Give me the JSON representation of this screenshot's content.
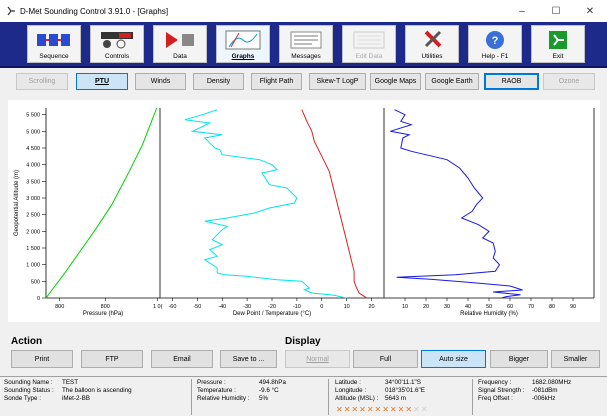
{
  "window": {
    "title": "D-Met Sounding Control 3.91.0 - [Graphs]",
    "minimize": "–",
    "maximize": "☐",
    "close": "✕"
  },
  "toolbar": [
    {
      "label": "Sequence",
      "icon": "sequence-icon",
      "state": "normal"
    },
    {
      "label": "Controls",
      "icon": "controls-icon",
      "state": "normal"
    },
    {
      "label": "Data",
      "icon": "data-icon",
      "state": "normal"
    },
    {
      "label": "Graphs",
      "icon": "graphs-icon",
      "state": "active"
    },
    {
      "label": "Messages",
      "icon": "messages-icon",
      "state": "normal"
    },
    {
      "label": "Edit Data",
      "icon": "edit-data-icon",
      "state": "disabled"
    },
    {
      "label": "Utilities",
      "icon": "utilities-icon",
      "state": "normal"
    },
    {
      "label": "Help - F1",
      "icon": "help-icon",
      "state": "normal"
    },
    {
      "label": "Exit",
      "icon": "exit-icon",
      "state": "normal"
    }
  ],
  "tabs": [
    {
      "label": "Scrolling",
      "state": "disabled"
    },
    {
      "label": "PTU",
      "state": "active"
    },
    {
      "label": "Winds",
      "state": "normal"
    },
    {
      "label": "Density",
      "state": "normal"
    },
    {
      "label": "Flight Path",
      "state": "normal"
    },
    {
      "label": "Skew-T LogP",
      "state": "normal"
    },
    {
      "label": "Google Maps",
      "state": "normal"
    },
    {
      "label": "Google Earth",
      "state": "normal"
    },
    {
      "label": "RAOB",
      "state": "selected"
    },
    {
      "label": "Ozone",
      "state": "disabled"
    }
  ],
  "chart_data": {
    "type": "line",
    "ylabel": "Geopotential Altitude (m)",
    "ylim": [
      0,
      5700
    ],
    "yticks": [
      "0",
      "500",
      "1 000",
      "1 500",
      "2 000",
      "2 500",
      "3 000",
      "3 500",
      "4 000",
      "4 500",
      "5 000",
      "5 500"
    ],
    "grid": false,
    "panels": [
      {
        "xlabel": "Pressure (hPa)",
        "xlim": [
          1000,
          480
        ],
        "xticks": [
          "800",
          "800",
          "1 0("
        ],
        "series": [
          {
            "color": "#00d000",
            "points": [
              [
                495,
                5700
              ],
              [
                560,
                4600
              ],
              [
                620,
                3800
              ],
              [
                700,
                2800
              ],
              [
                780,
                2000
              ],
              [
                850,
                1350
              ],
              [
                920,
                700
              ],
              [
                1000,
                0
              ]
            ]
          }
        ]
      },
      {
        "xlabel": "Dew Point / Temperature (°C)",
        "xlim": [
          -65,
          25
        ],
        "xticks": [
          "-60",
          "-50",
          "-40",
          "-30",
          "-20",
          "-10",
          "0",
          "10",
          "20"
        ],
        "series": [
          {
            "color": "#00e5ee",
            "points": [
              [
                -42,
                5650
              ],
              [
                -48,
                5500
              ],
              [
                -55,
                5350
              ],
              [
                -45,
                5250
              ],
              [
                -52,
                5000
              ],
              [
                -40,
                4900
              ],
              [
                -47,
                4800
              ],
              [
                -43,
                4500
              ],
              [
                -41,
                4450
              ],
              [
                -40,
                4300
              ],
              [
                -25,
                4150
              ],
              [
                -20,
                4000
              ],
              [
                -18,
                3850
              ],
              [
                -24,
                3750
              ],
              [
                -21,
                3400
              ],
              [
                -14,
                3300
              ],
              [
                -10,
                3000
              ],
              [
                -11,
                2850
              ],
              [
                -21,
                2700
              ],
              [
                -27,
                2550
              ],
              [
                -38,
                2400
              ],
              [
                -47,
                2300
              ],
              [
                -38,
                2150
              ],
              [
                -40,
                2050
              ],
              [
                -42,
                1900
              ],
              [
                -44,
                1750
              ],
              [
                -40,
                1600
              ],
              [
                -45,
                1450
              ],
              [
                -42,
                1250
              ],
              [
                -47,
                1150
              ],
              [
                -42,
                900
              ],
              [
                -42,
                750
              ],
              [
                -39,
                700
              ],
              [
                -30,
                650
              ],
              [
                -18,
                550
              ],
              [
                -8,
                500
              ],
              [
                -5,
                300
              ],
              [
                -7,
                250
              ],
              [
                -4,
                150
              ],
              [
                5,
                80
              ],
              [
                8,
                30
              ],
              [
                10,
                0
              ]
            ]
          },
          {
            "color": "#e02020",
            "points": [
              [
                -8,
                5650
              ],
              [
                -6,
                5300
              ],
              [
                -4,
                5000
              ],
              [
                -3,
                4700
              ],
              [
                -1,
                4400
              ],
              [
                1,
                4100
              ],
              [
                3,
                3800
              ],
              [
                4,
                3500
              ],
              [
                5,
                3200
              ],
              [
                6,
                2900
              ],
              [
                7,
                2600
              ],
              [
                8,
                2300
              ],
              [
                9,
                2000
              ],
              [
                10,
                1700
              ],
              [
                11,
                1400
              ],
              [
                12,
                1100
              ],
              [
                13,
                800
              ],
              [
                13,
                500
              ],
              [
                14,
                300
              ],
              [
                15,
                150
              ],
              [
                17,
                50
              ],
              [
                18,
                0
              ]
            ]
          }
        ]
      },
      {
        "xlabel": "Relative Humidity (%)",
        "xlim": [
          0,
          100
        ],
        "xticks": [
          "10",
          "20",
          "30",
          "40",
          "50",
          "60",
          "70",
          "80",
          "90"
        ],
        "series": [
          {
            "color": "#1a1ae6",
            "points": [
              [
                5,
                5650
              ],
              [
                10,
                5500
              ],
              [
                8,
                5300
              ],
              [
                13,
                5200
              ],
              [
                3,
                5000
              ],
              [
                12,
                4900
              ],
              [
                9,
                4800
              ],
              [
                8,
                4500
              ],
              [
                13,
                4400
              ],
              [
                30,
                4150
              ],
              [
                36,
                3900
              ],
              [
                40,
                3600
              ],
              [
                43,
                3300
              ],
              [
                47,
                3000
              ],
              [
                44,
                2800
              ],
              [
                42,
                2600
              ],
              [
                37,
                2400
              ],
              [
                45,
                2200
              ],
              [
                50,
                2000
              ],
              [
                47,
                1800
              ],
              [
                52,
                1650
              ],
              [
                53,
                1400
              ],
              [
                52,
                1200
              ],
              [
                55,
                1000
              ],
              [
                53,
                800
              ],
              [
                34,
                700
              ],
              [
                6,
                620
              ],
              [
                22,
                560
              ],
              [
                40,
                470
              ],
              [
                60,
                360
              ],
              [
                66,
                240
              ],
              [
                52,
                180
              ],
              [
                65,
                100
              ],
              [
                58,
                40
              ],
              [
                56,
                0
              ]
            ]
          }
        ]
      }
    ]
  },
  "action": {
    "title": "Action",
    "buttons": [
      "Print",
      "FTP",
      "Email",
      "Save to ..."
    ]
  },
  "display": {
    "title": "Display",
    "buttons": [
      {
        "label": "Normal",
        "state": "disabled"
      },
      {
        "label": "Full",
        "state": "normal"
      },
      {
        "label": "Auto size",
        "state": "active"
      },
      {
        "label": "Bigger",
        "state": "normal"
      },
      {
        "label": "Smaller",
        "state": "normal"
      }
    ]
  },
  "status": {
    "sounding_name_label": "Sounding Name :",
    "sounding_name": "TEST",
    "sounding_status_label": "Sounding Status :",
    "sounding_status": "The balloon is ascending",
    "sonde_type_label": "Sonde Type :",
    "sonde_type": "iMet-2-BB",
    "pressure_label": "Pressure :",
    "pressure": "494.8hPa",
    "temperature_label": "Temperature :",
    "temperature": "-9.6 °C",
    "humidity_label": "Relative Humidity :",
    "humidity": "5%",
    "latitude_label": "Latitude :",
    "latitude": "34°00'11.1\"S",
    "longitude_label": "Longitude :",
    "longitude": "018°35'01.6\"E",
    "altitude_label": "Altitude (MSL) :",
    "altitude": "5643 m",
    "frequency_label": "Frequency :",
    "frequency": "1682.080MHz",
    "signal_label": "Signal Strength :",
    "signal": "-081dBm",
    "freq_offset_label": "Freq Offset :",
    "freq_offset": "-006kHz"
  },
  "signal_bars": {
    "filled": 10,
    "total": 12,
    "color": "#e07a2a"
  }
}
